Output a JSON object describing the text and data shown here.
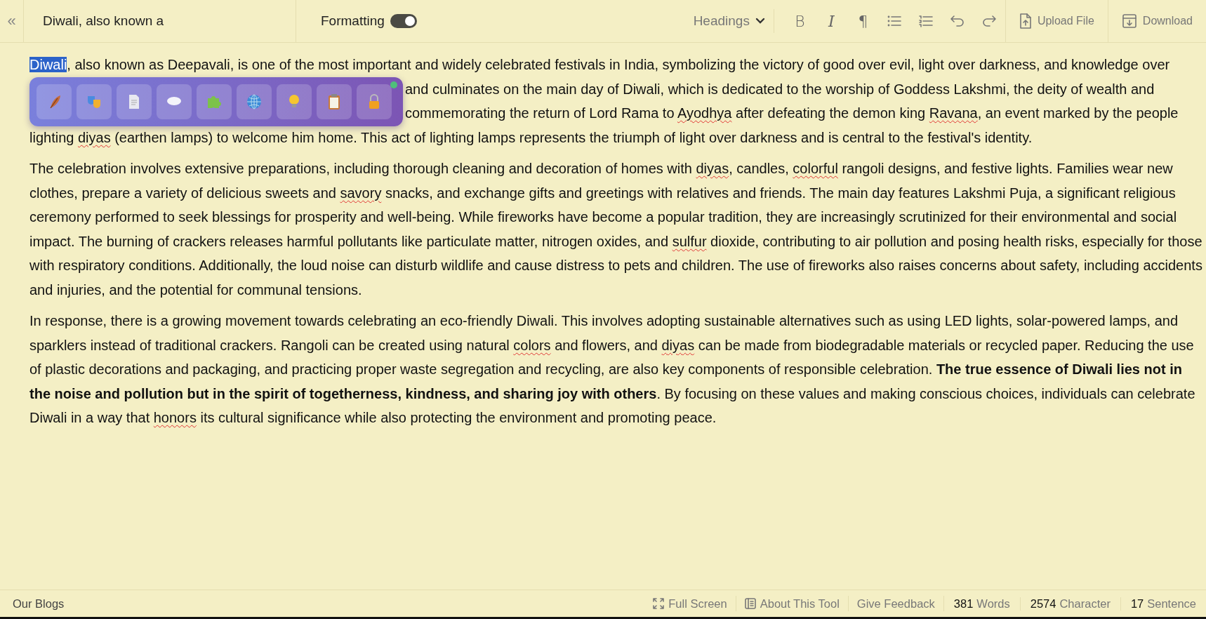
{
  "topbar": {
    "collapse": "«",
    "title": "Diwali, also known a",
    "formatting": {
      "label": "Formatting",
      "on": true
    },
    "headings": "Headings",
    "glyph_tools": [
      "B",
      "I",
      "¶"
    ],
    "upload": "Upload File",
    "download": "Download"
  },
  "floating_toolbar": {
    "online": true
  },
  "paragraphs": [
    {
      "lines": [
        {
          "runs": [
            {
              "kind": "selected",
              "text": "Diwali"
            },
            {
              "kind": "plain",
              "text": ", also known as Deepavali, is one of the most important and widely celebrated festivals in India, symbolizing the victory of good over evil, light over darkness, and knowledge over"
            }
          ]
        },
        {
          "covered": true,
          "runs": [
            {
              "kind": "plain",
              "text": "and culminates on the main day of Diwali, which is dedicated to the worship of Goddess Lakshmi, the deity of wealth and"
            }
          ]
        },
        {
          "covered": true,
          "runs": [
            {
              "kind": "plain",
              "text": "commemorating the return of Lord Rama to "
            },
            {
              "kind": "misspelled",
              "text": "Ayodhya"
            },
            {
              "kind": "plain",
              "text": " after defeating the demon king "
            },
            {
              "kind": "misspelled",
              "text": "Ravana"
            },
            {
              "kind": "plain",
              "text": ", an event marked by the people"
            }
          ]
        },
        {
          "runs": [
            {
              "kind": "plain",
              "text": "lighting "
            },
            {
              "kind": "misspelled",
              "text": "diyas"
            },
            {
              "kind": "plain",
              "text": " (earthen lamps) to welcome him home. This act of lighting lamps represents the triumph of light over darkness and is central to the festival's identity."
            }
          ]
        }
      ]
    },
    {
      "lines": [
        {
          "runs": [
            {
              "kind": "plain",
              "text": "The celebration involves extensive preparations, including thorough cleaning and decoration of homes with "
            },
            {
              "kind": "misspelled",
              "text": "diyas"
            },
            {
              "kind": "plain",
              "text": ", candles, "
            },
            {
              "kind": "misspelled",
              "text": "colorful"
            },
            {
              "kind": "plain",
              "text": " rangoli designs, and festive lights. Families wear new"
            }
          ]
        },
        {
          "runs": [
            {
              "kind": "plain",
              "text": "clothes, prepare a variety of delicious sweets and "
            },
            {
              "kind": "misspelled",
              "text": "savory"
            },
            {
              "kind": "plain",
              "text": " snacks, and exchange gifts and greetings with relatives and friends. The main day features Lakshmi Puja, a significant religious"
            }
          ]
        },
        {
          "runs": [
            {
              "kind": "plain",
              "text": "ceremony performed to seek blessings for prosperity and well-being. While fireworks have become a popular tradition, they are increasingly scrutinized for their environmental and social"
            }
          ]
        },
        {
          "runs": [
            {
              "kind": "plain",
              "text": "impact. The burning of crackers releases harmful pollutants like particulate matter, nitrogen oxides, and "
            },
            {
              "kind": "misspelled",
              "text": "sulfur"
            },
            {
              "kind": "plain",
              "text": " dioxide, contributing to air pollution and posing health risks, especially for those"
            }
          ]
        },
        {
          "runs": [
            {
              "kind": "plain",
              "text": "with respiratory conditions. Additionally, the loud noise can disturb wildlife and cause distress to pets and children. The use of fireworks also raises concerns about safety, including accidents"
            }
          ]
        },
        {
          "runs": [
            {
              "kind": "plain",
              "text": "and injuries, and the potential for communal tensions."
            }
          ]
        }
      ]
    },
    {
      "lines": [
        {
          "runs": [
            {
              "kind": "plain",
              "text": "In response, there is a growing movement towards celebrating an eco-friendly Diwali. This involves adopting sustainable alternatives such as using LED lights, solar-powered lamps, and"
            }
          ]
        },
        {
          "runs": [
            {
              "kind": "plain",
              "text": "sparklers instead of traditional crackers. Rangoli can be created using natural "
            },
            {
              "kind": "misspelled",
              "text": "colors"
            },
            {
              "kind": "plain",
              "text": " and flowers, and "
            },
            {
              "kind": "misspelled",
              "text": "diyas"
            },
            {
              "kind": "plain",
              "text": " can be made from biodegradable materials or recycled paper. Reducing the use"
            }
          ]
        },
        {
          "runs": [
            {
              "kind": "plain",
              "text": "of plastic decorations and packaging, and practicing proper waste segregation and recycling, are also key components of responsible celebration. "
            },
            {
              "kind": "bold",
              "text": "The true essence of Diwali lies not in"
            }
          ]
        },
        {
          "runs": [
            {
              "kind": "bold",
              "text": "the noise and pollution but in the spirit of togetherness, kindness, and sharing joy with others"
            },
            {
              "kind": "plain",
              "text": ". By focusing on these values and making conscious choices, individuals can celebrate"
            }
          ]
        },
        {
          "runs": [
            {
              "kind": "plain",
              "text": "Diwali in a way that "
            },
            {
              "kind": "misspelled",
              "text": "honors"
            },
            {
              "kind": "plain",
              "text": " its cultural significance while also protecting the environment and promoting peace."
            }
          ]
        }
      ]
    }
  ],
  "status_bar": {
    "blogs": "Our Blogs",
    "links": [
      {
        "kind": "fullscreen",
        "label": "Full Screen"
      },
      {
        "kind": "about",
        "label": "About This Tool"
      },
      {
        "kind": "plain",
        "label": "Give Feedback"
      }
    ],
    "counts": [
      {
        "number": "381",
        "unit": "Words"
      },
      {
        "number": "2574",
        "unit": "Character"
      },
      {
        "number": "17",
        "unit": "Sentence"
      }
    ]
  }
}
